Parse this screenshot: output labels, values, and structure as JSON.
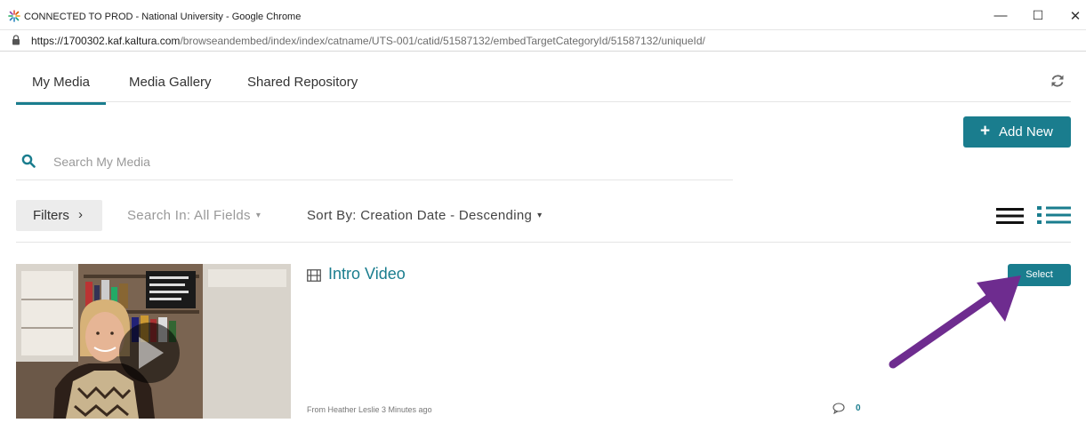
{
  "browser": {
    "window_title": "CONNECTED TO PROD - National University - Google Chrome",
    "url_host": "https://1700302.kaf.kaltura.com",
    "url_path": "/browseandembed/index/index/catname/UTS-001/catid/51587132/embedTargetCategoryId/51587132/uniqueId/",
    "controls": [
      "—",
      "☐",
      "✕"
    ]
  },
  "tabs": [
    {
      "label": "My Media",
      "active": true
    },
    {
      "label": "Media Gallery",
      "active": false
    },
    {
      "label": "Shared Repository",
      "active": false
    }
  ],
  "toolbar": {
    "add_new_label": "Add New",
    "add_new_icon": "plus-icon",
    "refresh_icon": "refresh-icon"
  },
  "search": {
    "placeholder": "Search My Media",
    "icon": "search-icon"
  },
  "filters": {
    "filters_label": "Filters",
    "search_in_label": "Search In: All Fields",
    "sort_by_label": "Sort By: Creation Date - Descending"
  },
  "media": [
    {
      "title": "Intro Video",
      "type_icon": "film-icon",
      "select_label": "Select",
      "from_text": "From Heather Leslie 3 Minutes ago",
      "comment_count": "0"
    }
  ],
  "colors": {
    "accent": "#1a7d8e",
    "arrow": "#6e2c8f"
  }
}
